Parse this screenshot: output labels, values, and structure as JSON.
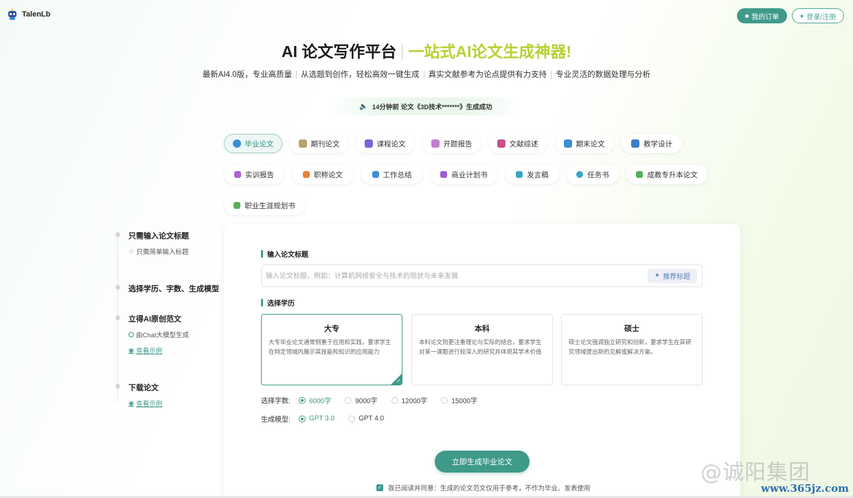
{
  "header": {
    "logo_text": "TalenLb",
    "orders_label": "我的订单",
    "login_label": "登录/注册"
  },
  "hero": {
    "title_left": "AI 论文写作平台",
    "title_right": "一站式AI论文生成神器!",
    "features": [
      "最新AI4.0版，专业高质量",
      "从选题到创作，轻松高效一键生成",
      "真实文献参考为论点提供有力支持",
      "专业灵活的数据处理与分析"
    ],
    "notice": "14分钟前 论文《3D技术*******》生成成功"
  },
  "tabs": [
    {
      "label": "毕业论文",
      "icon": "graduation-icon",
      "color": "#3b8fd6",
      "active": true
    },
    {
      "label": "期刊论文",
      "icon": "journal-icon",
      "color": "#b6a46a"
    },
    {
      "label": "课程论文",
      "icon": "course-icon",
      "color": "#7b63d6"
    },
    {
      "label": "开题报告",
      "icon": "proposal-icon",
      "color": "#c47ad0"
    },
    {
      "label": "文献综述",
      "icon": "literature-icon",
      "color": "#c8508b"
    },
    {
      "label": "期末论文",
      "icon": "final-icon",
      "color": "#3b8fd6"
    },
    {
      "label": "教学设计",
      "icon": "teaching-icon",
      "color": "#3b7fc8"
    },
    {
      "label": "实训报告",
      "icon": "training-icon",
      "color": "#b061d1"
    },
    {
      "label": "职称论文",
      "icon": "title-paper-icon",
      "color": "#e8823a"
    },
    {
      "label": "工作总结",
      "icon": "summary-icon",
      "color": "#3b8fd6"
    },
    {
      "label": "商业计划书",
      "icon": "business-plan-icon",
      "color": "#9d5fd6"
    },
    {
      "label": "发言稿",
      "icon": "speech-icon",
      "color": "#3aa6c8"
    },
    {
      "label": "任务书",
      "icon": "task-icon",
      "color": "#3aa6c8"
    },
    {
      "label": "成教专升本论文",
      "icon": "upgrade-icon",
      "color": "#5aae5a"
    },
    {
      "label": "职业生涯规划书",
      "icon": "career-icon",
      "color": "#5aae5a"
    }
  ],
  "steps": {
    "step1_title": "只需输入论文标题",
    "step1_sub": "只需简单输入标题",
    "step2_title": "选择学历、字数、生成模型",
    "step3_title": "立得AI原创范文",
    "step3_sub": "由Chat大模型生成",
    "step3_link": "查看示例",
    "step4_title": "下载论文",
    "step4_link": "查看示例"
  },
  "form": {
    "title_label": "输入论文标题",
    "title_placeholder": "输入论文标题，例如：计算机网络安全与技术的现状与未来发展",
    "title_value": "",
    "recommend_label": "推荐标题",
    "degree_label": "选择学历",
    "degrees": [
      {
        "name": "大专",
        "desc": "大专毕业论文通常侧重于应用和实践，要求学生在特定领域内展示其技能和知识的应用能力",
        "selected": true
      },
      {
        "name": "本科",
        "desc": "本科论文则更注重理论与实际的结合，要求学生对某一课题进行较深入的研究并体现其学术价值",
        "selected": false
      },
      {
        "name": "硕士",
        "desc": "硕士论文强调独立研究和创新，要求学生在其研究领域提出新的见解或解决方案。",
        "selected": false
      }
    ],
    "wordcount_label": "选择字数:",
    "wordcounts": [
      "6000字",
      "9000字",
      "12000字",
      "15000字"
    ],
    "wordcount_selected": "6000字",
    "model_label": "生成模型:",
    "models": [
      "GPT 3.0",
      "GPT 4.0"
    ],
    "model_selected": "GPT 3.0",
    "generate_label": "立即生成毕业论文",
    "agree_text": "我已阅读并同意：生成的论文范文仅用于参考，不作为毕业、发表使用",
    "agree_checked": true
  },
  "watermark": {
    "main": "@诚阳集团",
    "url": "www.365jz.com"
  },
  "colors": {
    "accent": "#3f9a8a",
    "hero_green": "#b8d032"
  }
}
